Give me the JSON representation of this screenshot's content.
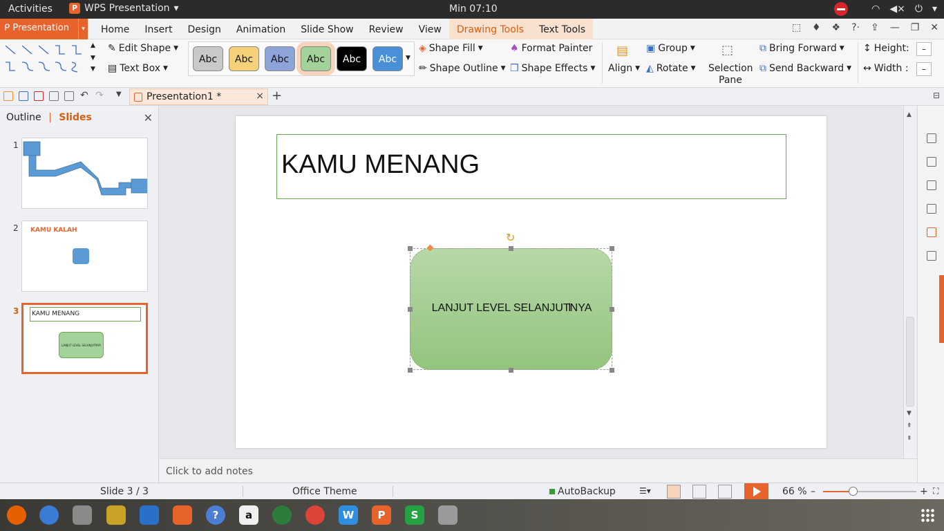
{
  "topbar": {
    "activities": "Activities",
    "app_name": "WPS Presentation",
    "clock": "Min 07:10"
  },
  "tabrow": {
    "menu_label": "Presentation",
    "tabs": [
      "Home",
      "Insert",
      "Design",
      "Animation",
      "Slide Show",
      "Review",
      "View"
    ],
    "context_tab": "Drawing Tools",
    "context_tab2": "Text Tools"
  },
  "ribbon": {
    "edit_shape": "Edit Shape",
    "text_box": "Text Box",
    "style_swatches": [
      {
        "label": "Abc",
        "bg": "#c9c9c9",
        "fg": "#111111"
      },
      {
        "label": "Abc",
        "bg": "#f5d27a",
        "fg": "#111111"
      },
      {
        "label": "Abc",
        "bg": "#8ea3d8",
        "fg": "#111111"
      },
      {
        "label": "Abc",
        "bg": "#a3d39a",
        "fg": "#111111"
      },
      {
        "label": "Abc",
        "bg": "#000000",
        "fg": "#ffffff"
      },
      {
        "label": "Abc",
        "bg": "#4a90d9",
        "fg": "#ffffff"
      }
    ],
    "shape_fill": "Shape Fill",
    "shape_outline": "Shape Outline",
    "format_painter": "Format Painter",
    "shape_effects": "Shape Effects",
    "align": "Align",
    "group": "Group",
    "rotate": "Rotate",
    "selection_pane_1": "Selection",
    "selection_pane_2": "Pane",
    "bring_forward": "Bring Forward",
    "send_backward": "Send Backward",
    "height": "Height:",
    "width": "Width :",
    "stepper": "–"
  },
  "doc_tab": {
    "title": "Presentation1 *"
  },
  "leftpane": {
    "outline_tab": "Outline",
    "slides_tab": "Slides",
    "slides": [
      {
        "num": "1"
      },
      {
        "num": "2",
        "title": "KAMU KALAH"
      },
      {
        "num": "3",
        "title": "KAMU MENANG",
        "button": "LANJUT LEVEL SELANJUTNYA"
      }
    ]
  },
  "slide": {
    "title": "KAMU MENANG",
    "shape_text": "LANJUT LEVEL SELANJUTNYA"
  },
  "notes": {
    "placeholder": "Click to add notes"
  },
  "status": {
    "slide_count": "Slide 3 / 3",
    "theme": "Office Theme",
    "autobackup": "AutoBackup",
    "zoom": "66 %"
  },
  "colors": {
    "accent": "#e8632b",
    "shape_fill": "#93c47d",
    "title_border": "#6aa84f"
  },
  "dock": [
    {
      "name": "firefox",
      "color": "#e66000"
    },
    {
      "name": "thunderbird",
      "color": "#3a7bd5"
    },
    {
      "name": "files",
      "color": "#8a8a8a"
    },
    {
      "name": "rhythmbox",
      "color": "#c9a227"
    },
    {
      "name": "writer",
      "color": "#2a6fc9"
    },
    {
      "name": "software",
      "color": "#e8632b"
    },
    {
      "name": "help",
      "color": "#4a7fd4"
    },
    {
      "name": "amazon",
      "color": "#f0f0f0"
    },
    {
      "name": "globe",
      "color": "#2d7d3a"
    },
    {
      "name": "chrome",
      "color": "#db4437"
    },
    {
      "name": "wps-writer",
      "color": "#2f8ee0"
    },
    {
      "name": "wps-presentation",
      "color": "#e8632b"
    },
    {
      "name": "wps-spreadsheet",
      "color": "#25a244"
    },
    {
      "name": "camera",
      "color": "#9a9a9a"
    }
  ]
}
